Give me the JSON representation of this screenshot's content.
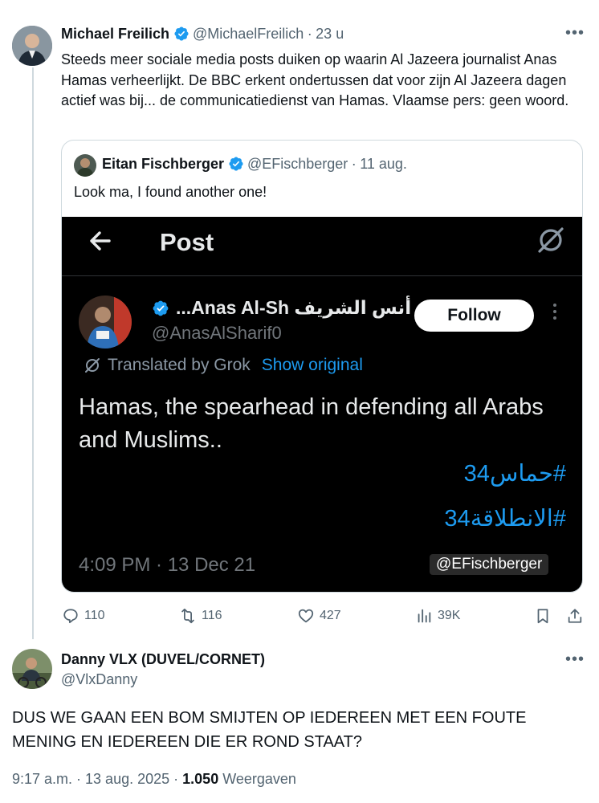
{
  "tweet": {
    "author_name": "Michael Freilich",
    "handle": "@MichaelFreilich",
    "separator": "·",
    "time": "23 u",
    "text": "Steeds meer sociale media posts duiken op waarin Al Jazeera journalist Anas Hamas verheerlijkt. De BBC erkent ondertussen dat voor zijn Al Jazeera dagen actief was bij... de communicatiedienst van Hamas. Vlaamse pers: geen woord.",
    "more_icon": "more-horizontal-icon",
    "verified_color": "#1d9bf0"
  },
  "quote": {
    "author_name": "Eitan Fischberger",
    "handle": "@EFischberger",
    "separator": "·",
    "time": "11 aug.",
    "text": "Look ma, I found another one!"
  },
  "embedded": {
    "header_title": "Post",
    "back_icon": "arrow-left-icon",
    "grok_icon": "grok-icon",
    "author_name": "...Anas Al-Sh أنس الشريف",
    "handle": "@AnasAlSharif0",
    "follow_label": "Follow",
    "translated_label": "Translated by Grok",
    "show_original_label": "Show original",
    "text": "Hamas, the spearhead in defending all Arabs and Muslims..",
    "hashtag1": "#حماس34",
    "hashtag2": "#الانطلاقة34",
    "timestamp": "4:09 PM · 13 Dec 21",
    "watermark": "@EFischberger",
    "link_color": "#1d9bf0"
  },
  "actions": {
    "replies": "110",
    "reposts": "116",
    "likes": "427",
    "views": "39K"
  },
  "reply": {
    "author_name": "Danny VLX (DUVEL/CORNET)",
    "handle": "@VlxDanny",
    "text": "DUS WE GAAN EEN BOM SMIJTEN OP IEDEREEN MET EEN FOUTE MENING EN IEDEREEN DIE ER ROND STAAT?",
    "time": "9:17 a.m. · 13 aug. 2025 ·",
    "views_count": "1.050",
    "views_label": "Weergaven"
  }
}
